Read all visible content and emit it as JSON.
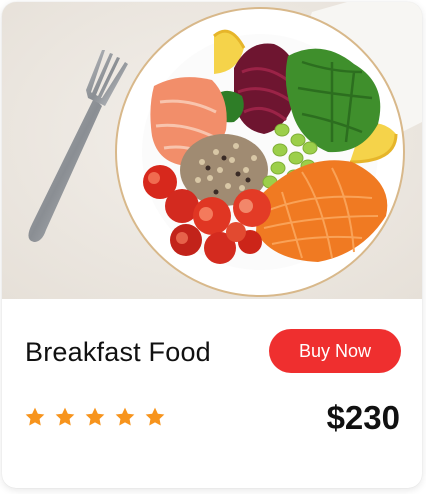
{
  "product": {
    "title": "Breakfast Food",
    "buy_label": "Buy Now",
    "price": "$230",
    "rating": 5,
    "rating_max": 5,
    "image_icon": "food-bowl-photo"
  },
  "colors": {
    "accent": "#ef2f2f",
    "star": "#f7941d",
    "text": "#111111"
  }
}
